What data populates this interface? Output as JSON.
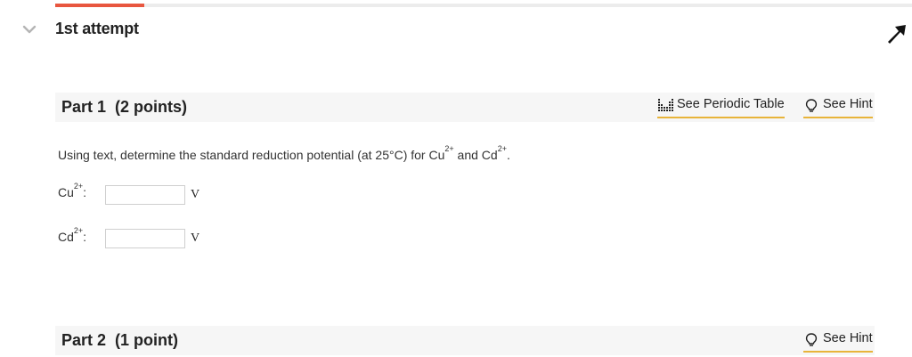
{
  "attempt": {
    "title": "1st attempt"
  },
  "parts": [
    {
      "label": "Part 1",
      "points": "(2 points)",
      "tools": {
        "periodic_table": "See Periodic Table",
        "hint": "See Hint"
      },
      "question": {
        "lead": "Using text, determine the standard reduction potential (at 25°C) for Cu",
        "cu_charge": "2+",
        "mid": " and Cd",
        "cd_charge": "2+",
        "end": "."
      },
      "answers": [
        {
          "ion": "Cu",
          "charge": "2+",
          "suffix": ":",
          "value": "",
          "unit": "V"
        },
        {
          "ion": "Cd",
          "charge": "2+",
          "suffix": ":",
          "value": "",
          "unit": "V"
        }
      ]
    },
    {
      "label": "Part 2",
      "points": "(1 point)",
      "tools": {
        "hint": "See Hint"
      }
    }
  ],
  "icons": {
    "collapse": "chevron-down-icon",
    "pin": "pin-icon",
    "periodic_table": "periodic-table-icon",
    "hint": "lightbulb-icon"
  },
  "colors": {
    "accent": "#e8563f",
    "link_underline": "#e8b43a",
    "header_bg": "#f6f6f6",
    "chevron": "#b5b5b5"
  }
}
